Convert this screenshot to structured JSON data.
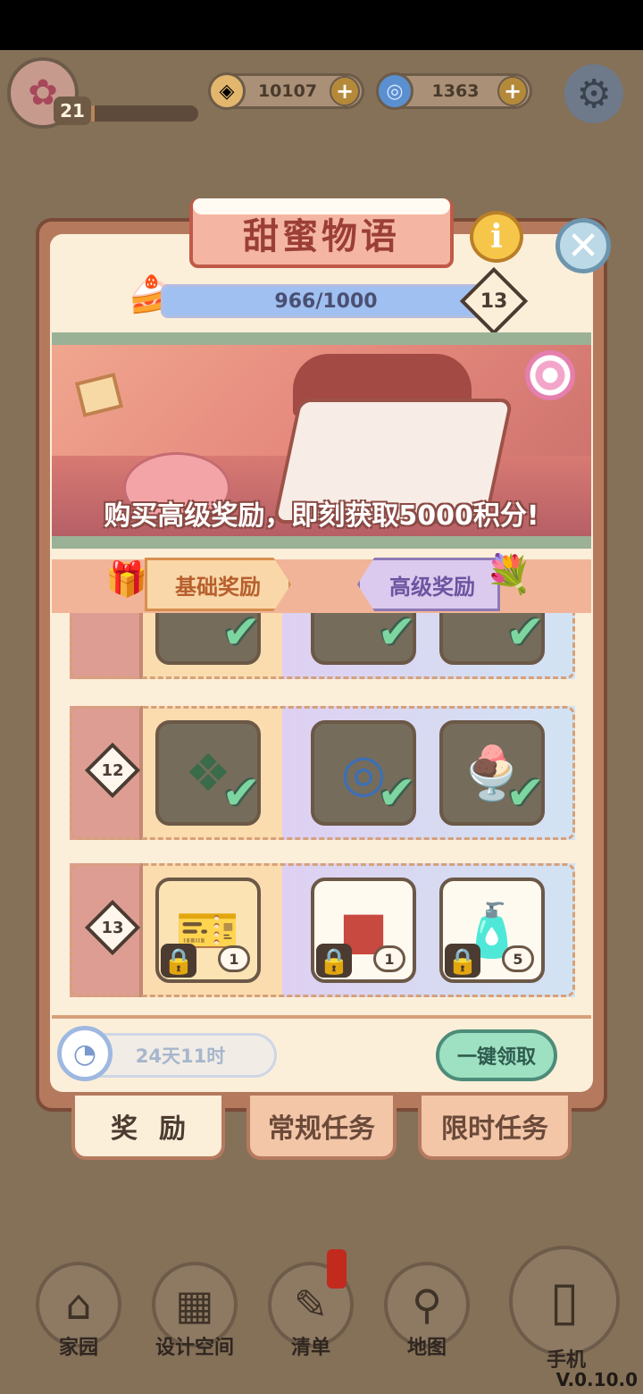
{
  "hud": {
    "level": "21",
    "xp_fraction": 0.08,
    "coins": "10107",
    "gems": "1363",
    "plus": "+",
    "avatar_icon": "tulip-icon",
    "settings_icon": "gear-icon"
  },
  "panel": {
    "title": "甜蜜物语",
    "info": "i",
    "close": "✕",
    "progress_text": "966/1000",
    "progress_fraction": 0.966,
    "pass_level": "13",
    "banner_caption": "购买高级奖励，即刻获取5000积分!",
    "tab_basic": "基础奖励",
    "tab_premium": "高级奖励"
  },
  "rows": [
    {
      "level": "12",
      "basic": {
        "icon": "leaf-token-icon",
        "claimed": true
      },
      "premium": [
        {
          "icon": "blue-swirl-icon",
          "claimed": true
        },
        {
          "icon": "ice-cream-sundae-icon",
          "claimed": true
        }
      ]
    },
    {
      "level": "13",
      "basic": {
        "icon": "ticket-icon",
        "claimed": false,
        "qty": "1"
      },
      "premium": [
        {
          "icon": "cake-box-icon",
          "claimed": false,
          "qty": "1"
        },
        {
          "icon": "spray-bottle-icon",
          "claimed": false,
          "qty": "5"
        }
      ]
    }
  ],
  "footer": {
    "timer": "24天11时",
    "claim_all": "一键领取"
  },
  "bottom_tabs": {
    "rewards": "奖励",
    "regular_tasks": "常规任务",
    "limited_tasks": "限时任务"
  },
  "nav": {
    "home": "家园",
    "design": "设计空间",
    "list": "清单",
    "map": "地图",
    "phone": "手机"
  },
  "version": "V.0.10.0",
  "colors": {
    "accent_claim": "#9de0c2",
    "check": "#7dd6a0",
    "title_text": "#9b3f36"
  }
}
